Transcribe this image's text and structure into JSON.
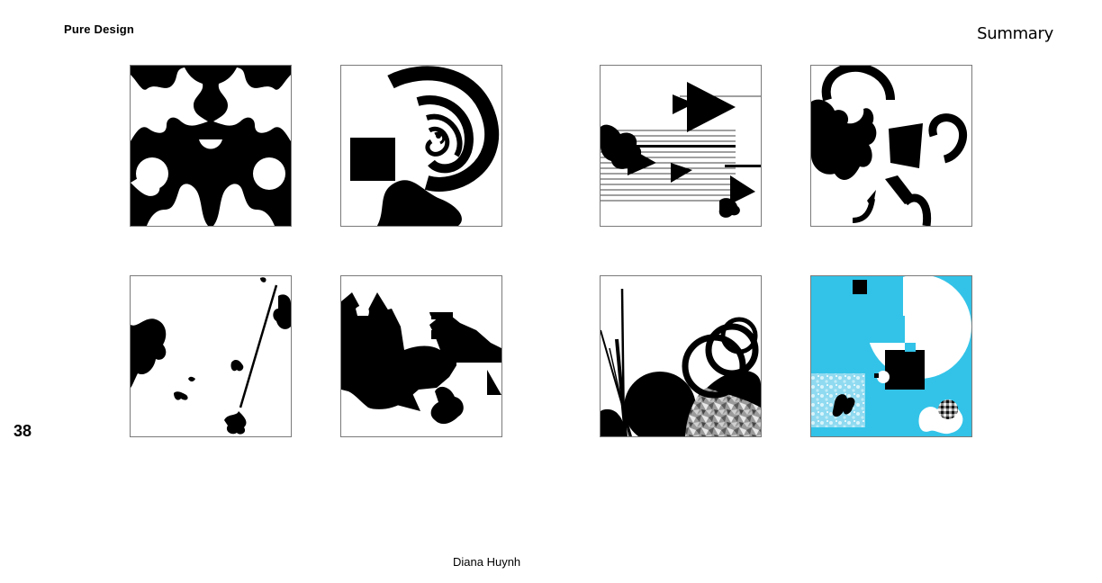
{
  "header": {
    "section_title": "Pure Design",
    "page_title": "Summary"
  },
  "page_number": "38",
  "author": "Diana Huynh",
  "colors": {
    "ink": "#000000",
    "accent_cyan": "#33c3e8",
    "frame": "#7a7a7a"
  },
  "artworks": [
    {
      "name": "symmetric-blob-composition"
    },
    {
      "name": "spiral-arcs-composition"
    },
    {
      "name": "triangles-and-lines-composition"
    },
    {
      "name": "broken-rings-composition"
    },
    {
      "name": "scattered-splats-composition"
    },
    {
      "name": "triangles-and-blocks-composition"
    },
    {
      "name": "circles-and-textures-composition"
    },
    {
      "name": "cyan-collage-composition"
    }
  ]
}
